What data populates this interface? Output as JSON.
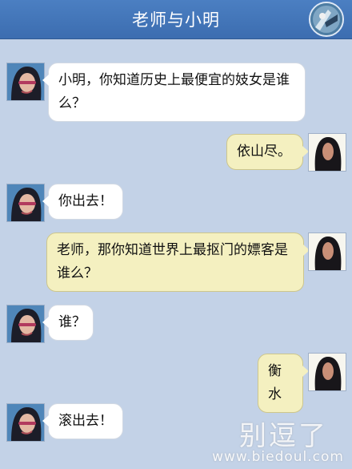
{
  "header": {
    "title": "老师与小明",
    "avatar_icon": "contact-avatar-icon"
  },
  "messages": [
    {
      "sender": "teacher",
      "side": "left",
      "text": "小明，你知道历史上最便宜的妓女是谁么？"
    },
    {
      "sender": "xiaoming",
      "side": "right",
      "text": "依山尽。"
    },
    {
      "sender": "teacher",
      "side": "left",
      "text": "你出去！"
    },
    {
      "sender": "xiaoming",
      "side": "right",
      "text": "老师，那你知道世界上最抠门的嫖客是谁么？"
    },
    {
      "sender": "teacher",
      "side": "left",
      "text": "谁？"
    },
    {
      "sender": "xiaoming",
      "side": "right",
      "text": "衡水"
    },
    {
      "sender": "teacher",
      "side": "left",
      "text": "滚出去！"
    }
  ],
  "watermark": {
    "text": "别逗了",
    "url": "www.biedoul.com"
  },
  "colors": {
    "background": "#c3d2e7",
    "header": "#4171b5",
    "left_bubble": "#ffffff",
    "right_bubble": "#f4f0c0"
  }
}
